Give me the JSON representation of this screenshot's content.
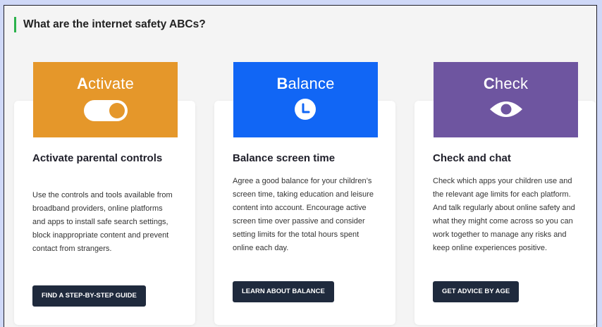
{
  "section": {
    "heading": "What are the internet safety ABCs?"
  },
  "colors": {
    "accent_bar": "#2bb24c",
    "activate_tile": "#e5972a",
    "balance_tile": "#1166f5",
    "check_tile": "#6e55a0",
    "button_bg": "#1f2a3d"
  },
  "cards": [
    {
      "tile_letter": "A",
      "tile_rest": "ctivate",
      "tile_icon": "toggle-switch-icon",
      "title": "Activate parental controls",
      "text": "Use the controls and tools available from broadband providers, online platforms and apps to install safe search settings, block inappropriate content and prevent contact from strangers.",
      "button": "FIND A STEP-BY-STEP GUIDE"
    },
    {
      "tile_letter": "B",
      "tile_rest": "alance",
      "tile_icon": "clock-icon",
      "title": "Balance screen time",
      "text": "Agree a good balance for your children’s screen time, taking education and leisure content into account. Encourage active screen time over passive and consider setting limits for the total hours spent online each day.",
      "button": "LEARN ABOUT BALANCE"
    },
    {
      "tile_letter": "C",
      "tile_rest": "heck",
      "tile_icon": "eye-icon",
      "title": "Check and chat",
      "text": "Check which apps your children use and the relevant age limits for each platform. And talk regularly about online safety and what they might come across so you can work together to manage any risks and keep online experiences positive.",
      "button": "GET ADVICE BY AGE"
    }
  ]
}
